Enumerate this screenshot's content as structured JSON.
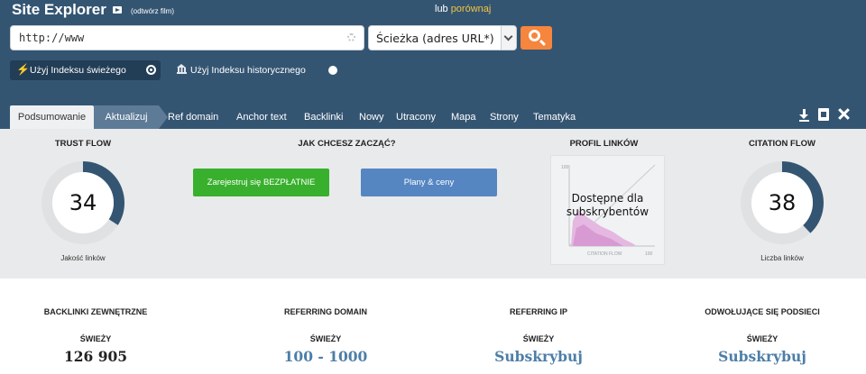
{
  "header": {
    "title": "Site Explorer",
    "video_link": "(odtwórz film)",
    "compare_prefix": "lub",
    "compare_link": "porównaj"
  },
  "search": {
    "url_value": "http://www",
    "scope_value": "Ścieżka (adres URL*)"
  },
  "index_options": {
    "fresh_label": "Użyj Indeksu świeżego",
    "historic_label": "Użyj Indeksu historycznego"
  },
  "tabs": [
    {
      "label": "Podsumowanie"
    },
    {
      "label": "Aktualizuj"
    },
    {
      "label": "Ref domain"
    },
    {
      "label": "Anchor text"
    },
    {
      "label": "Backlinki"
    },
    {
      "label": "Nowy"
    },
    {
      "label": "Utracony"
    },
    {
      "label": "Mapa"
    },
    {
      "label": "Strony"
    },
    {
      "label": "Tematyka"
    }
  ],
  "panel": {
    "trust_flow": {
      "title": "TRUST FLOW",
      "value": "34",
      "caption": "Jakość linków",
      "fraction": 0.34,
      "color": "#345572"
    },
    "start": {
      "title": "JAK CHCESZ ZACZĄĆ?",
      "signup_label": "Zarejestruj się BEZPŁATNIE",
      "plans_label": "Plany & ceny"
    },
    "profile": {
      "title": "PROFIL LINKÓW",
      "overlay_line1": "Dostępne dla",
      "overlay_line2": "subskrybentów",
      "x_label": "CITATION FLOW",
      "y_max_label": "100",
      "x_max_label": "100"
    },
    "citation_flow": {
      "title": "CITATION FLOW",
      "value": "38",
      "caption": "Liczba linków",
      "fraction": 0.38,
      "color": "#345572"
    }
  },
  "stats": [
    {
      "title": "BACKLINKI ZEWNĘTRZNE",
      "sub": "ŚWIEŻY",
      "value": "126 905",
      "color": "#222222"
    },
    {
      "title": "REFERRING DOMAIN",
      "sub": "ŚWIEŻY",
      "value": "100 - 1000",
      "color": "#4d7ea8"
    },
    {
      "title": "REFERRING IP",
      "sub": "ŚWIEŻY",
      "value": "Subskrybuj",
      "color": "#4d7ea8"
    },
    {
      "title": "ODWOŁUJĄCE SIĘ PODSIECI",
      "sub": "ŚWIEŻY",
      "value": "Subskrybuj",
      "color": "#4d7ea8"
    }
  ],
  "colors": {
    "header_bg": "#345572",
    "accent_orange": "#f6853d",
    "signup_green": "#39b02d",
    "plans_blue": "#5586c2",
    "compare_yellow": "#f2c43d"
  }
}
